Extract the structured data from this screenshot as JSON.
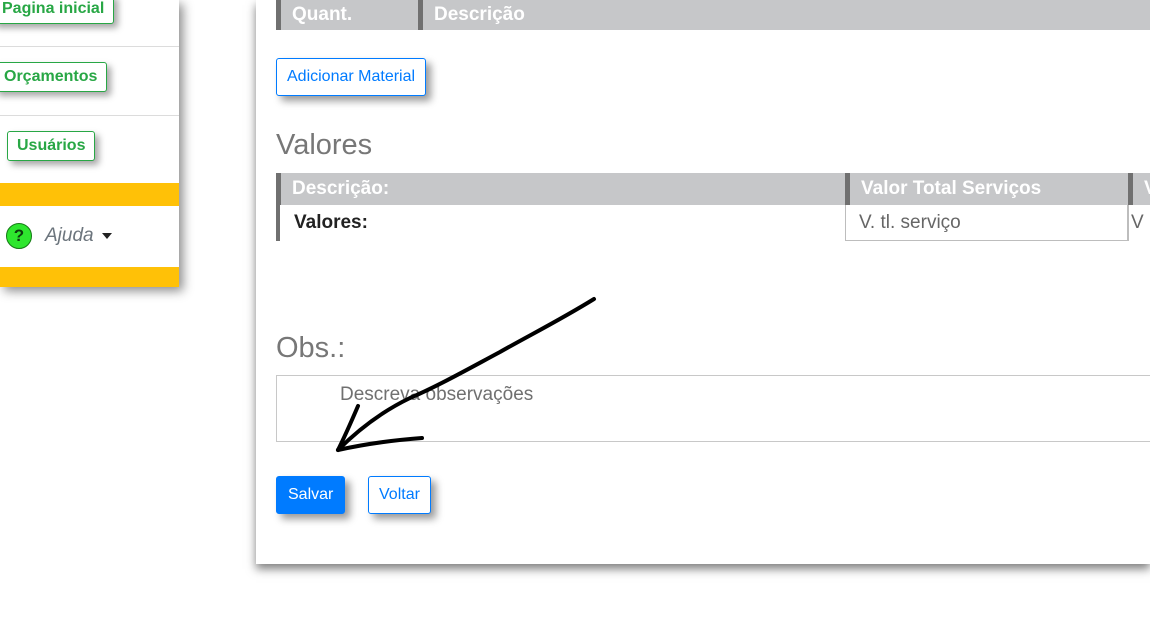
{
  "sidebar": {
    "items": [
      {
        "label": "Pagina inicial"
      },
      {
        "label": "Orçamentos"
      },
      {
        "label": "Usuários"
      }
    ],
    "help": {
      "icon": "?",
      "label": "Ajuda"
    },
    "accent_color": "#ffc107"
  },
  "materials": {
    "headers": [
      "Quant.",
      "Descrição"
    ],
    "add_button_label": "Adicionar Material"
  },
  "valores": {
    "title": "Valores",
    "headers": [
      "Descrição:",
      "Valor Total Serviços",
      "V"
    ],
    "row": {
      "label": "Valores:",
      "service_total": "V. tl. serviço",
      "next": "V"
    }
  },
  "obs": {
    "title": "Obs.:",
    "placeholder": "Descreva observações"
  },
  "actions": {
    "save_label": "Salvar",
    "back_label": "Voltar"
  },
  "colors": {
    "primary": "#007bff",
    "success": "#28a745",
    "table_header": "#c6c7c9"
  }
}
